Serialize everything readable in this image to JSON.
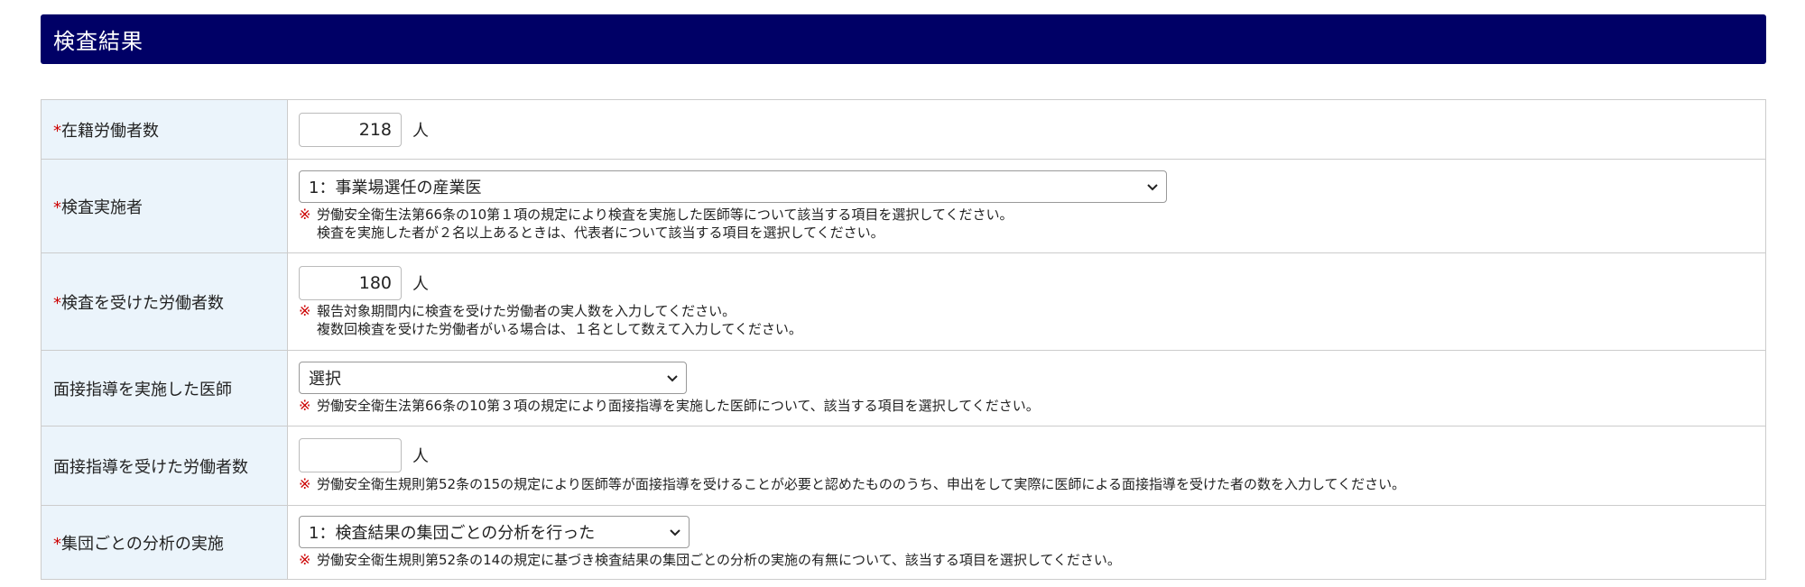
{
  "section": {
    "title": "検査結果"
  },
  "required_mark": "*",
  "note_mark": "※",
  "rows": [
    {
      "label": "在籍労働者数",
      "value": "218",
      "unit": "人"
    },
    {
      "label": "検査実施者",
      "selected": "1：事業場選任の産業医",
      "note_line1": "労働安全衛生法第66条の10第１項の規定により検査を実施した医師等について該当する項目を選択してください。",
      "note_line2": "検査を実施した者が２名以上あるときは、代表者について該当する項目を選択してください。"
    },
    {
      "label": "検査を受けた労働者数",
      "value": "180",
      "unit": "人",
      "note_line1": "報告対象期間内に検査を受けた労働者の実人数を入力してください。",
      "note_line2": "複数回検査を受けた労働者がいる場合は、１名として数えて入力してください。"
    },
    {
      "label": "面接指導を実施した医師",
      "selected": "選択",
      "note_line1": "労働安全衛生法第66条の10第３項の規定により面接指導を実施した医師について、該当する項目を選択してください。"
    },
    {
      "label": "面接指導を受けた労働者数",
      "value": "",
      "unit": "人",
      "note_line1": "労働安全衛生規則第52条の15の規定により医師等が面接指導を受けることが必要と認めたもののうち、申出をして実際に医師による面接指導を受けた者の数を入力してください。"
    },
    {
      "label": "集団ごとの分析の実施",
      "selected": "1：検査結果の集団ごとの分析を行った",
      "note_line1": "労働安全衛生規則第52条の14の規定に基づき検査結果の集団ごとの分析の実施の有無について、該当する項目を選択してください。"
    }
  ],
  "colors": {
    "header_bg": "#000066",
    "label_bg": "#ebf4fb",
    "required": "#cc0000",
    "border": "#cccccc"
  },
  "icons": {
    "dropdown": "chevron-down-icon"
  }
}
